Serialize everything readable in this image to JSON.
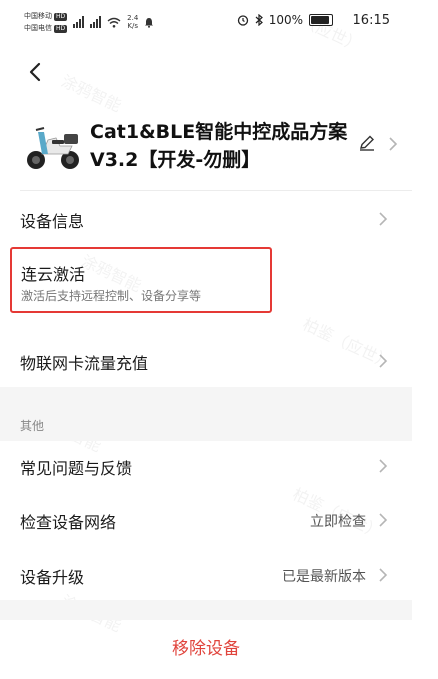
{
  "status_bar": {
    "carrier1": "中国移动",
    "carrier2": "中国电信",
    "hd": "HD",
    "net_speed": "2.4",
    "net_unit": "K/s",
    "battery": "100%",
    "time": "16:15"
  },
  "header": {
    "device_title": "Cat1&BLE智能中控成品方案V3.2【开发-勿删】"
  },
  "rows": {
    "device_info": "设备信息",
    "cloud_activate": "连云激活",
    "cloud_activate_sub": "激活后支持远程控制、设备分享等",
    "iot_topup": "物联网卡流量充值",
    "section_other": "其他",
    "faq": "常见问题与反馈",
    "check_network": "检查设备网络",
    "check_network_value": "立即检查",
    "upgrade": "设备升级",
    "upgrade_value": "已是最新版本"
  },
  "remove_label": "移除设备",
  "colors": {
    "accent_red": "#e53935",
    "remove_text": "#e0443c"
  }
}
